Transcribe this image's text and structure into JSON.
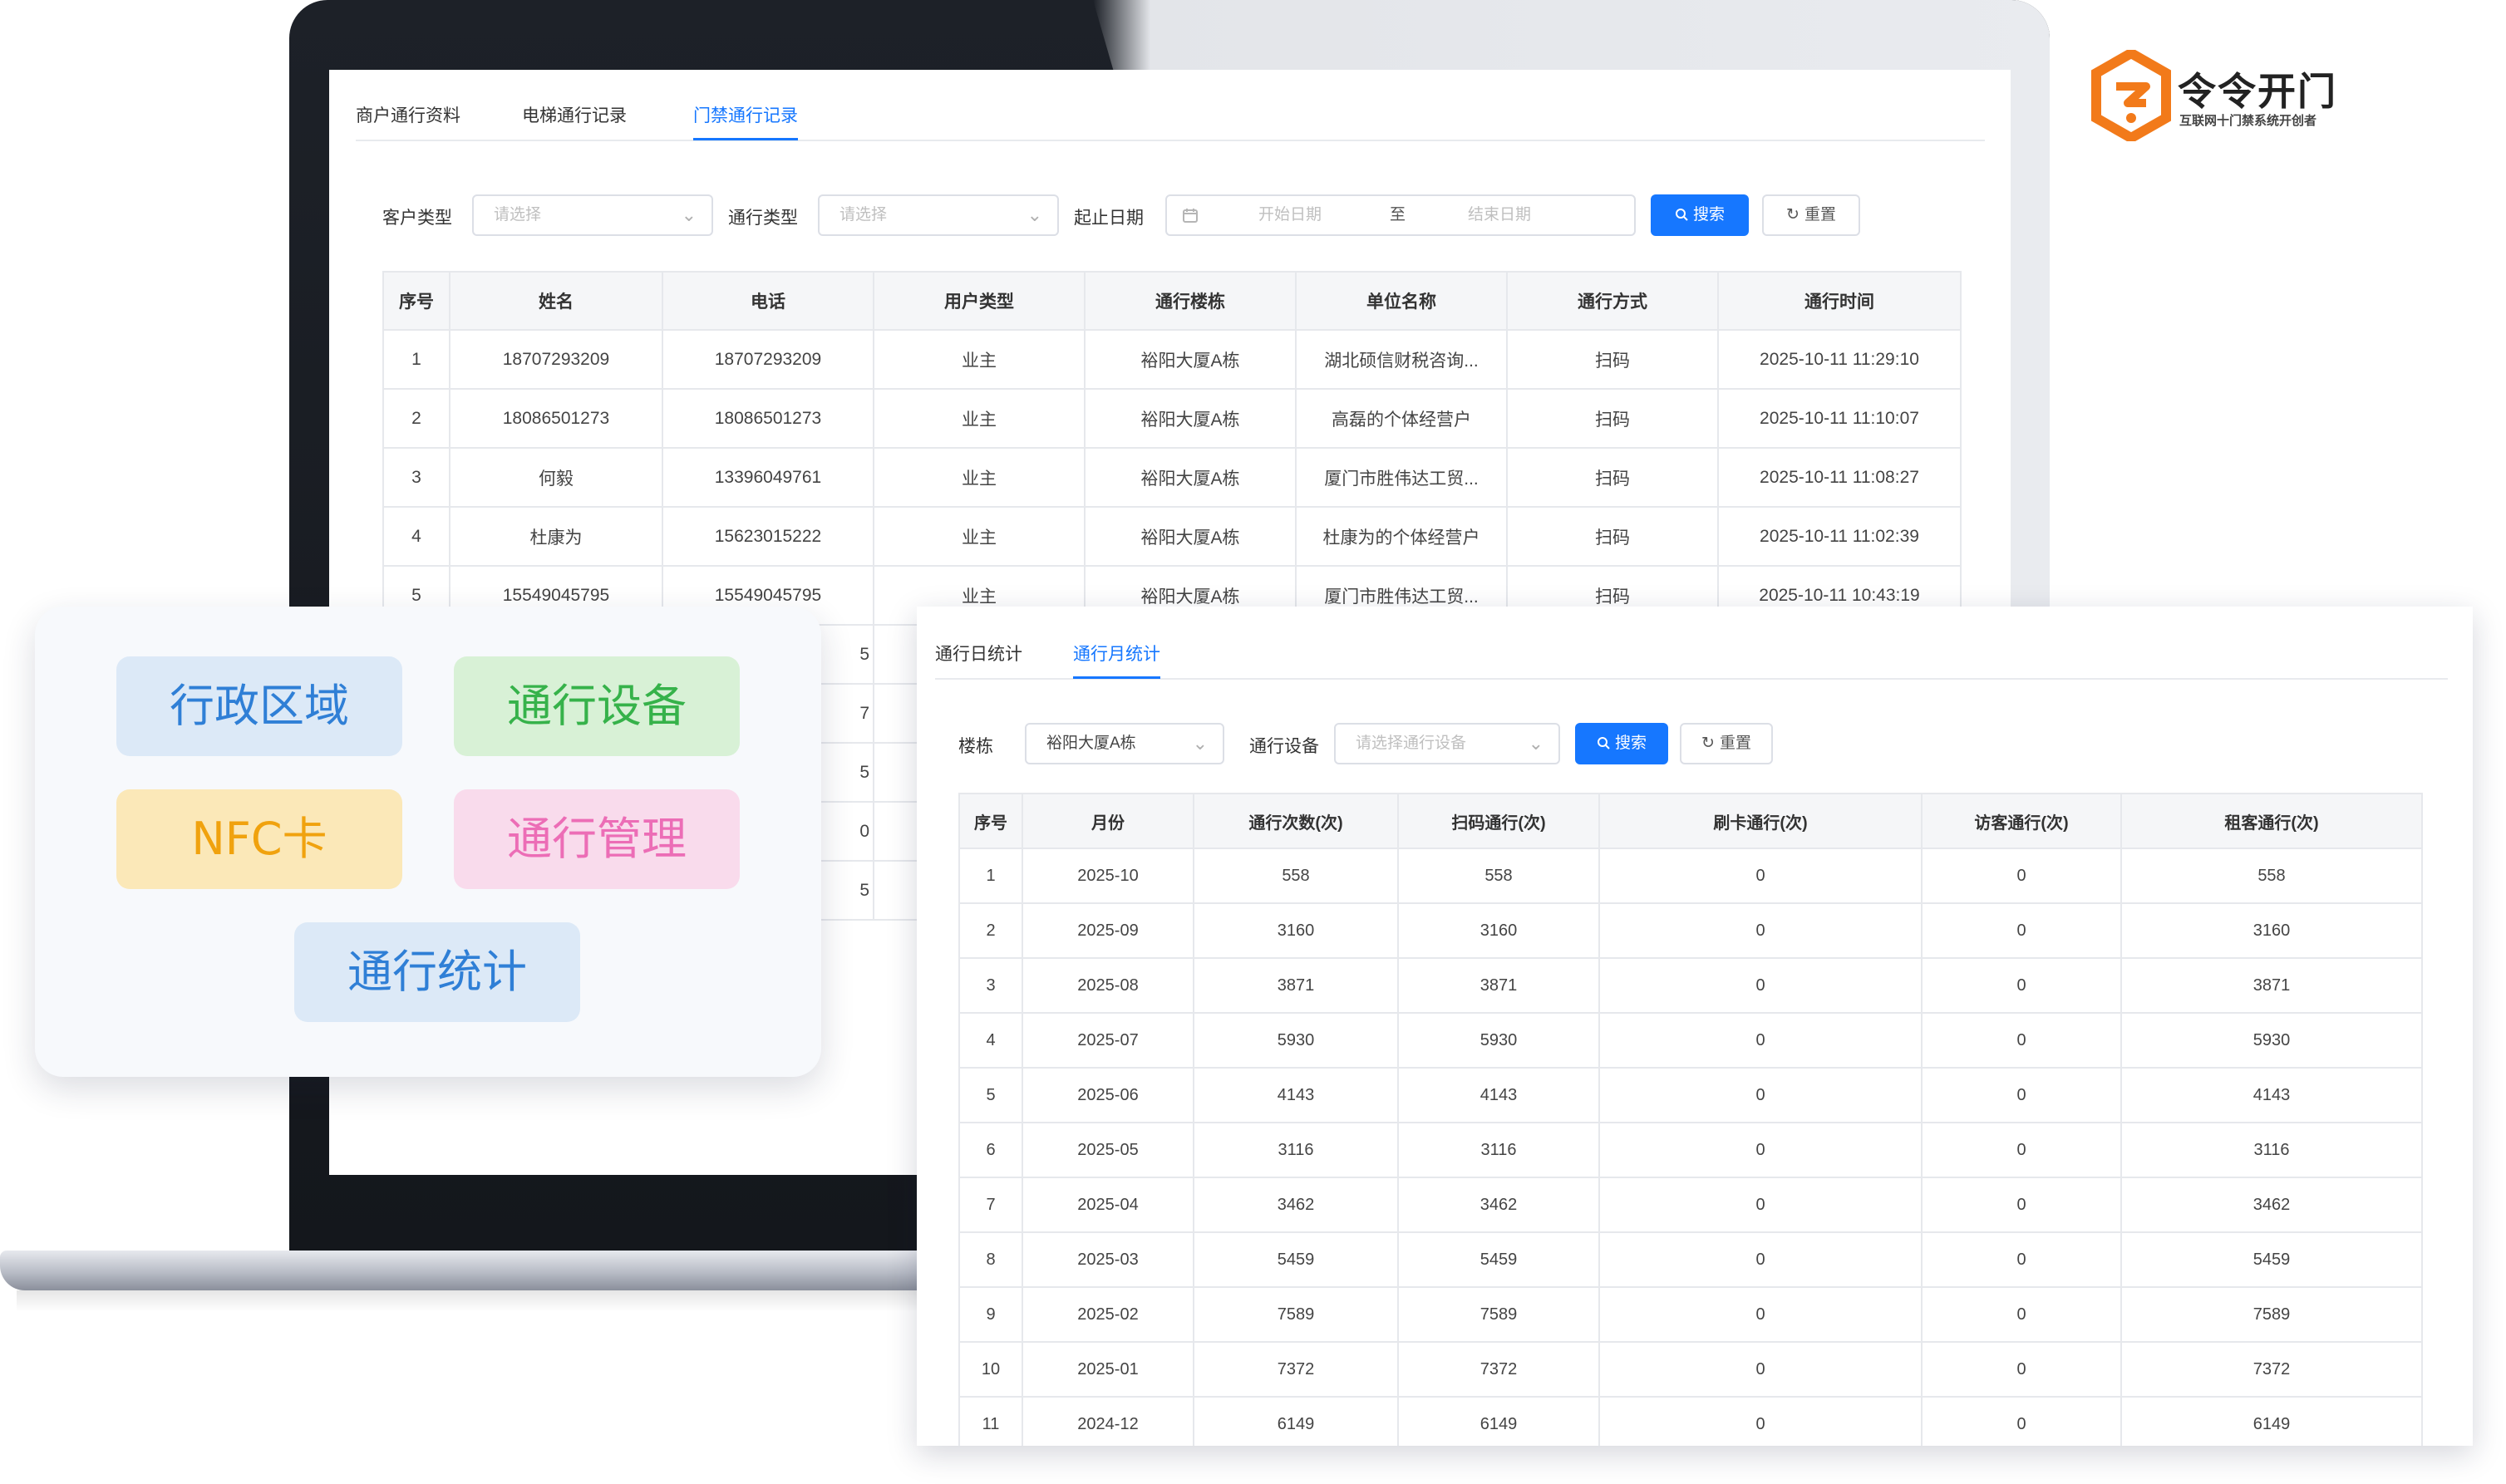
{
  "brand": {
    "name": "令令开门",
    "tagline": "互联网十门禁系统开创者",
    "color": "#f27a1a"
  },
  "back_window": {
    "tabs": [
      {
        "label": "商户通行资料",
        "active": false
      },
      {
        "label": "电梯通行记录",
        "active": false
      },
      {
        "label": "门禁通行记录",
        "active": true
      }
    ],
    "filters": {
      "customer_type_label": "客户类型",
      "customer_type_placeholder": "请选择",
      "pass_type_label": "通行类型",
      "pass_type_placeholder": "请选择",
      "date_range_label": "起止日期",
      "start_placeholder": "开始日期",
      "range_sep": "至",
      "end_placeholder": "结束日期",
      "search_label": "搜索",
      "reset_label": "重置"
    },
    "table": {
      "headers": [
        "序号",
        "姓名",
        "电话",
        "用户类型",
        "通行楼栋",
        "单位名称",
        "通行方式",
        "通行时间"
      ],
      "rows": [
        [
          "1",
          "18707293209",
          "18707293209",
          "业主",
          "裕阳大厦A栋",
          "湖北硕信财税咨询...",
          "扫码",
          "2025-10-11 11:29:10"
        ],
        [
          "2",
          "18086501273",
          "18086501273",
          "业主",
          "裕阳大厦A栋",
          "高磊的个体经营户",
          "扫码",
          "2025-10-11 11:10:07"
        ],
        [
          "3",
          "何毅",
          "13396049761",
          "业主",
          "裕阳大厦A栋",
          "厦门市胜伟达工贸...",
          "扫码",
          "2025-10-11 11:08:27"
        ],
        [
          "4",
          "杜康为",
          "15623015222",
          "业主",
          "裕阳大厦A栋",
          "杜康为的个体经营户",
          "扫码",
          "2025-10-11 11:02:39"
        ],
        [
          "5",
          "15549045795",
          "15549045795",
          "业主",
          "裕阳大厦A栋",
          "厦门市胜伟达工贸...",
          "扫码",
          "2025-10-11 10:43:19"
        ]
      ],
      "partial_rows": [
        "5",
        "7",
        "5",
        "0",
        "5"
      ]
    }
  },
  "category_card": {
    "chips": [
      {
        "label": "行政区域",
        "bg": "#dce9f7",
        "fg": "#2f7fd6"
      },
      {
        "label": "通行设备",
        "bg": "#d8f1d6",
        "fg": "#36b24a"
      },
      {
        "label": "NFC卡",
        "bg": "#fbe8b8",
        "fg": "#f0a20e"
      },
      {
        "label": "通行管理",
        "bg": "#f9dbec",
        "fg": "#ec6db6"
      },
      {
        "label": "通行统计",
        "bg": "#dce9f7",
        "fg": "#2f7fd6"
      }
    ]
  },
  "front_window": {
    "tabs": [
      {
        "label": "通行日统计",
        "active": false
      },
      {
        "label": "通行月统计",
        "active": true
      }
    ],
    "filters": {
      "building_label": "楼栋",
      "building_value": "裕阳大厦A栋",
      "device_label": "通行设备",
      "device_placeholder": "请选择通行设备",
      "search_label": "搜索",
      "reset_label": "重置"
    },
    "table": {
      "headers": [
        "序号",
        "月份",
        "通行次数(次)",
        "扫码通行(次)",
        "刷卡通行(次)",
        "访客通行(次)",
        "租客通行(次)"
      ],
      "rows": [
        [
          "1",
          "2025-10",
          "558",
          "558",
          "0",
          "0",
          "558"
        ],
        [
          "2",
          "2025-09",
          "3160",
          "3160",
          "0",
          "0",
          "3160"
        ],
        [
          "3",
          "2025-08",
          "3871",
          "3871",
          "0",
          "0",
          "3871"
        ],
        [
          "4",
          "2025-07",
          "5930",
          "5930",
          "0",
          "0",
          "5930"
        ],
        [
          "5",
          "2025-06",
          "4143",
          "4143",
          "0",
          "0",
          "4143"
        ],
        [
          "6",
          "2025-05",
          "3116",
          "3116",
          "0",
          "0",
          "3116"
        ],
        [
          "7",
          "2025-04",
          "3462",
          "3462",
          "0",
          "0",
          "3462"
        ],
        [
          "8",
          "2025-03",
          "5459",
          "5459",
          "0",
          "0",
          "5459"
        ],
        [
          "9",
          "2025-02",
          "7589",
          "7589",
          "0",
          "0",
          "7589"
        ],
        [
          "10",
          "2025-01",
          "7372",
          "7372",
          "0",
          "0",
          "7372"
        ],
        [
          "11",
          "2024-12",
          "6149",
          "6149",
          "0",
          "0",
          "6149"
        ]
      ]
    }
  },
  "icons": {
    "search": "search-icon",
    "reset": "refresh-icon",
    "calendar": "calendar-icon",
    "dropdown": "chevron-down-icon"
  }
}
